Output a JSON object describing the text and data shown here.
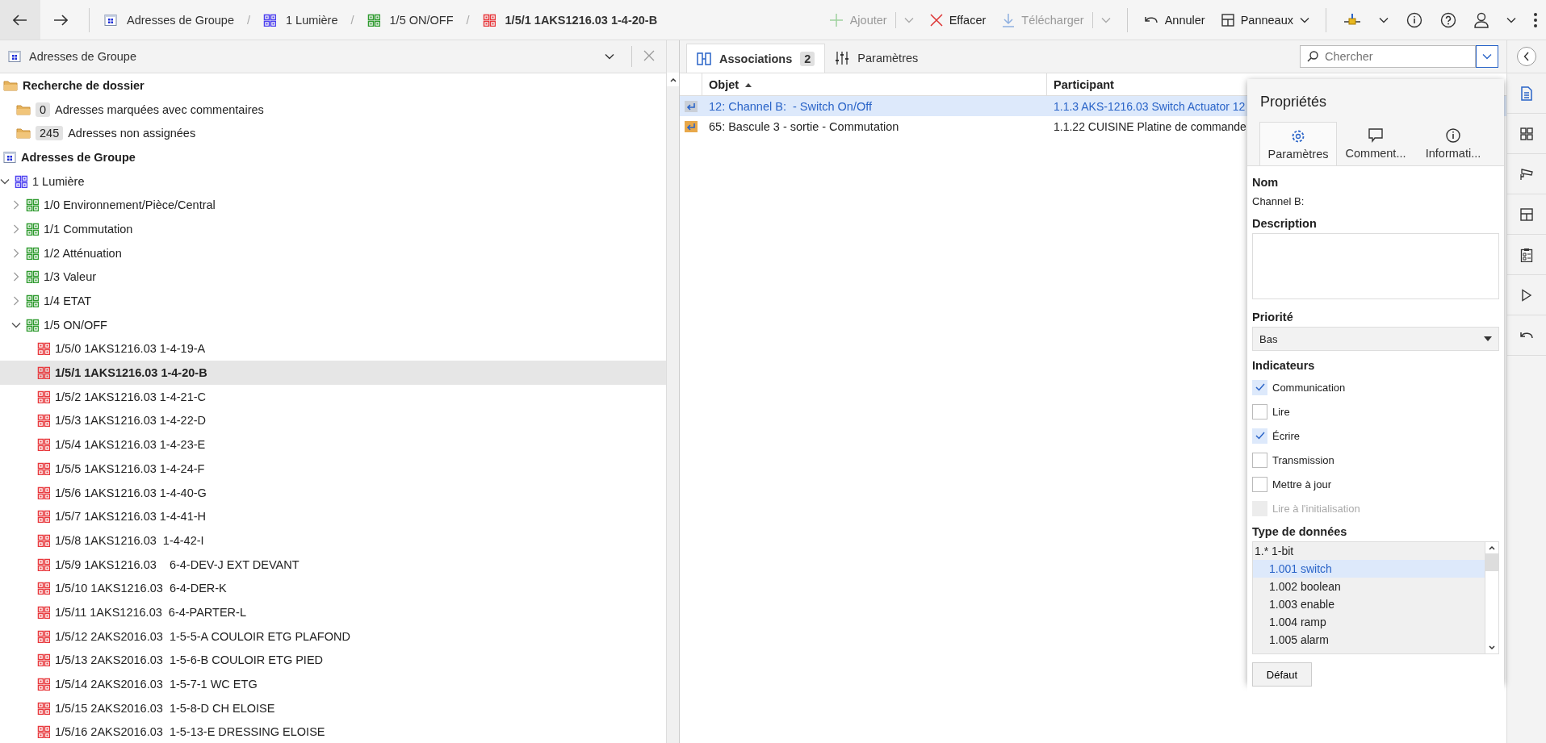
{
  "toolbar": {
    "separator": "/",
    "breadcrumbs": [
      {
        "kind": "root",
        "label": "Adresses de Groupe"
      },
      {
        "kind": "main_group",
        "label": "1 Lumière"
      },
      {
        "kind": "middle_group",
        "label": "1/5 ON/OFF"
      },
      {
        "kind": "group_address",
        "label": "1/5/1 1AKS1216.03 1-4-20-B"
      }
    ],
    "actions": [
      {
        "kind": "add",
        "label": "Ajouter",
        "disabled": true,
        "dropdown": true
      },
      {
        "kind": "delete",
        "label": "Effacer",
        "disabled": false,
        "dropdown": false
      },
      {
        "kind": "download",
        "label": "Télécharger",
        "disabled": true,
        "dropdown": true
      },
      {
        "kind": "undo",
        "label": "Annuler",
        "disabled": false,
        "dropdown": false
      },
      {
        "kind": "panels",
        "label": "Panneaux",
        "disabled": false,
        "dropdown": true
      }
    ]
  },
  "left_panel": {
    "title": "Adresses de Groupe",
    "search_folders": {
      "label": "Recherche de dossier",
      "children": [
        {
          "count": "0",
          "label": "Adresses marquées avec commentaires"
        },
        {
          "count": "245",
          "label": "Adresses non assignées"
        }
      ]
    },
    "tree": {
      "label": "Adresses de Groupe",
      "children": [
        {
          "kind": "main_group",
          "label": "1 Lumière",
          "expanded": true,
          "selected": false,
          "children": [
            {
              "kind": "middle_group",
              "label": "1/0 Environnement/Pièce/Central",
              "expanded": false,
              "selected": false
            },
            {
              "kind": "middle_group",
              "label": "1/1 Commutation",
              "expanded": false,
              "selected": false
            },
            {
              "kind": "middle_group",
              "label": "1/2 Atténuation",
              "expanded": false,
              "selected": false
            },
            {
              "kind": "middle_group",
              "label": "1/3 Valeur",
              "expanded": false,
              "selected": false
            },
            {
              "kind": "middle_group",
              "label": "1/4 ETAT",
              "expanded": false,
              "selected": false
            },
            {
              "kind": "middle_group",
              "label": "1/5 ON/OFF",
              "expanded": true,
              "selected": false,
              "children": [
                {
                  "kind": "group_address",
                  "label": "1/5/0 1AKS1216.03 1-4-19-A",
                  "selected": false
                },
                {
                  "kind": "group_address",
                  "label": "1/5/1 1AKS1216.03 1-4-20-B",
                  "selected": true
                },
                {
                  "kind": "group_address",
                  "label": "1/5/2 1AKS1216.03 1-4-21-C",
                  "selected": false
                },
                {
                  "kind": "group_address",
                  "label": "1/5/3 1AKS1216.03 1-4-22-D",
                  "selected": false
                },
                {
                  "kind": "group_address",
                  "label": "1/5/4 1AKS1216.03 1-4-23-E",
                  "selected": false
                },
                {
                  "kind": "group_address",
                  "label": "1/5/5 1AKS1216.03 1-4-24-F",
                  "selected": false
                },
                {
                  "kind": "group_address",
                  "label": "1/5/6 1AKS1216.03 1-4-40-G",
                  "selected": false
                },
                {
                  "kind": "group_address",
                  "label": "1/5/7 1AKS1216.03 1-4-41-H",
                  "selected": false
                },
                {
                  "kind": "group_address",
                  "label": "1/5/8 1AKS1216.03  1-4-42-I",
                  "selected": false
                },
                {
                  "kind": "group_address",
                  "label": "1/5/9 1AKS1216.03    6-4-DEV-J EXT DEVANT",
                  "selected": false
                },
                {
                  "kind": "group_address",
                  "label": "1/5/10 1AKS1216.03  6-4-DER-K",
                  "selected": false
                },
                {
                  "kind": "group_address",
                  "label": "1/5/11 1AKS1216.03  6-4-PARTER-L",
                  "selected": false
                },
                {
                  "kind": "group_address",
                  "label": "1/5/12 2AKS2016.03  1-5-5-A COULOIR ETG PLAFOND",
                  "selected": false
                },
                {
                  "kind": "group_address",
                  "label": "1/5/13 2AKS2016.03  1-5-6-B COULOIR ETG PIED",
                  "selected": false
                },
                {
                  "kind": "group_address",
                  "label": "1/5/14 2AKS2016.03  1-5-7-1 WC ETG",
                  "selected": false
                },
                {
                  "kind": "group_address",
                  "label": "1/5/15 2AKS2016.03  1-5-8-D CH ELOISE",
                  "selected": false
                },
                {
                  "kind": "group_address",
                  "label": "1/5/16 2AKS2016.03  1-5-13-E DRESSING ELOISE",
                  "selected": false
                }
              ]
            }
          ]
        }
      ]
    }
  },
  "center": {
    "tabs": [
      {
        "label": "Associations",
        "count": "2",
        "selected": true
      },
      {
        "label": "Paramètres",
        "selected": false
      }
    ],
    "search": {
      "placeholder": "Chercher"
    },
    "table": {
      "columns": [
        "Objet",
        "Participant"
      ],
      "rows": [
        {
          "object": "12: Channel B:  - Switch On/Off",
          "participant": "1.1.3 AKS-1216.03 Switch Actuator 12",
          "selected": true
        },
        {
          "object": "65: Bascule 3 - sortie - Commutation",
          "participant": "1.1.22 CUISINE Platine de commande",
          "selected": false
        }
      ]
    }
  },
  "properties": {
    "title": "Propriétés",
    "tabs": [
      {
        "kind": "settings",
        "label": "Paramètres",
        "selected": true
      },
      {
        "kind": "comment",
        "label": "Comment...",
        "selected": false
      },
      {
        "kind": "info",
        "label": "Informati...",
        "selected": false
      }
    ],
    "name_label": "Nom",
    "name_value": "Channel B:",
    "description_label": "Description",
    "priority_label": "Priorité",
    "priority_value": "Bas",
    "flags_label": "Indicateurs",
    "flags": [
      {
        "label": "Communication",
        "checked": true,
        "disabled": false
      },
      {
        "label": "Lire",
        "checked": false,
        "disabled": false
      },
      {
        "label": "Écrire",
        "checked": true,
        "disabled": false
      },
      {
        "label": "Transmission",
        "checked": false,
        "disabled": false
      },
      {
        "label": "Mettre à jour",
        "checked": false,
        "disabled": false
      },
      {
        "label": "Lire à l'initialisation",
        "checked": false,
        "disabled": true
      }
    ],
    "datatype_label": "Type de données",
    "datatypes": {
      "label": "1.* 1-bit",
      "children": [
        {
          "label": "1.001 switch",
          "selected": true
        },
        {
          "label": "1.002 boolean",
          "selected": false
        },
        {
          "label": "1.003 enable",
          "selected": false
        },
        {
          "label": "1.004 ramp",
          "selected": false
        },
        {
          "label": "1.005 alarm",
          "selected": false
        }
      ]
    },
    "default_button": "Défaut"
  },
  "right_rail": [
    {
      "kind": "document",
      "selected": true
    },
    {
      "kind": "grid",
      "selected": false
    },
    {
      "kind": "camera",
      "selected": false
    },
    {
      "kind": "layout",
      "selected": false
    },
    {
      "kind": "clipboard",
      "selected": false
    },
    {
      "kind": "play",
      "selected": false
    },
    {
      "kind": "undo",
      "selected": false
    }
  ]
}
